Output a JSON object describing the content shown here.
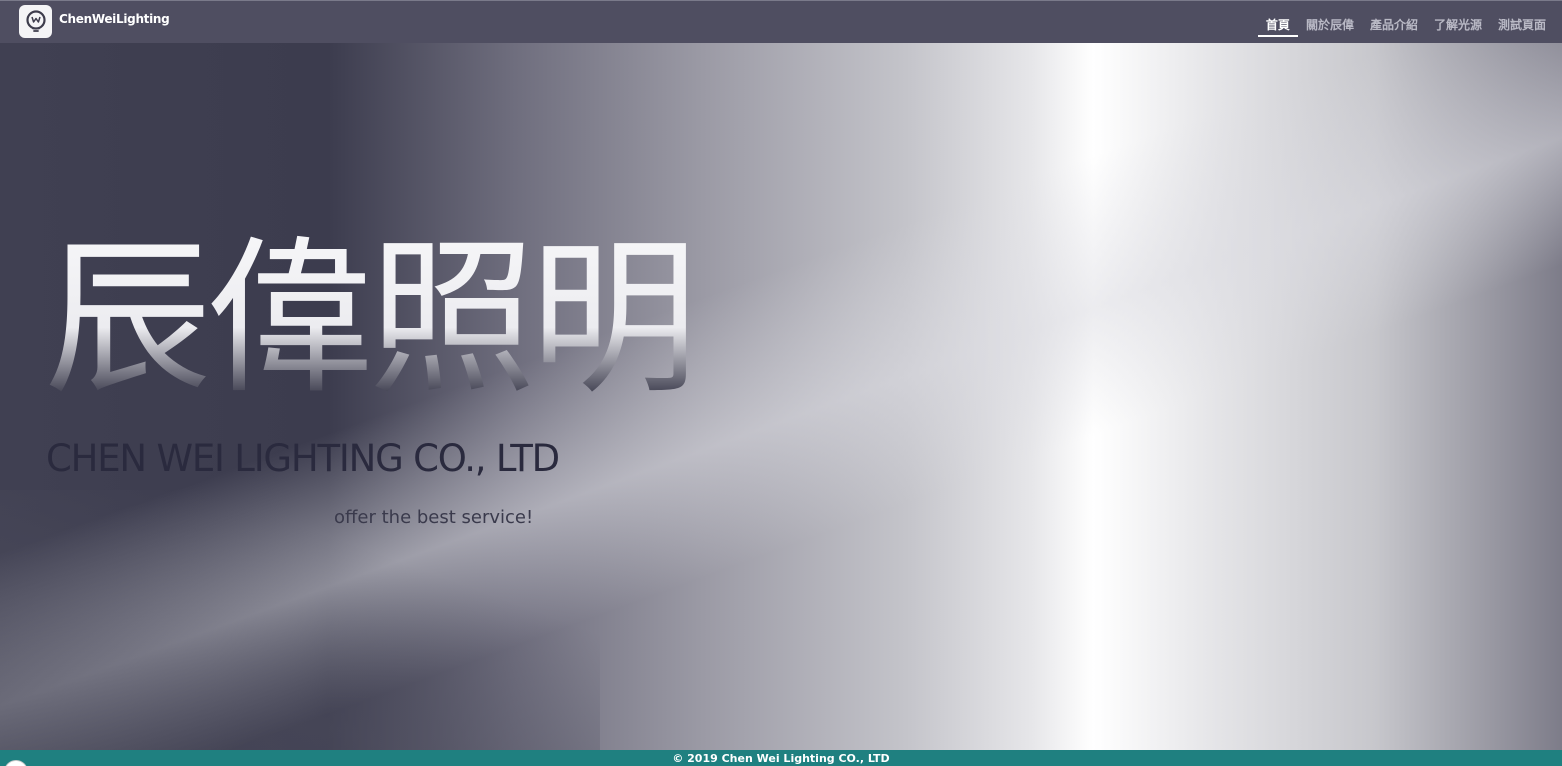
{
  "brand": {
    "name": "ChenWeiLighting",
    "logo_icon": "lightbulb-w-icon"
  },
  "nav": {
    "items": [
      {
        "label": "首頁",
        "active": true
      },
      {
        "label": "關於辰偉",
        "active": false
      },
      {
        "label": "產品介紹",
        "active": false
      },
      {
        "label": "了解光源",
        "active": false
      },
      {
        "label": "測試頁面",
        "active": false
      }
    ]
  },
  "hero": {
    "title": "辰偉照明",
    "subtitle": "CHEN WEI LIGHTING CO., LTD",
    "tagline": "offer the best service!"
  },
  "footer": {
    "copyright": "© 2019 Chen Wei Lighting CO., LTD"
  },
  "colors": {
    "navbar_bg": "#4f4e61",
    "footer_bg": "#1f8080",
    "title_dark": "#2a2a3c"
  }
}
